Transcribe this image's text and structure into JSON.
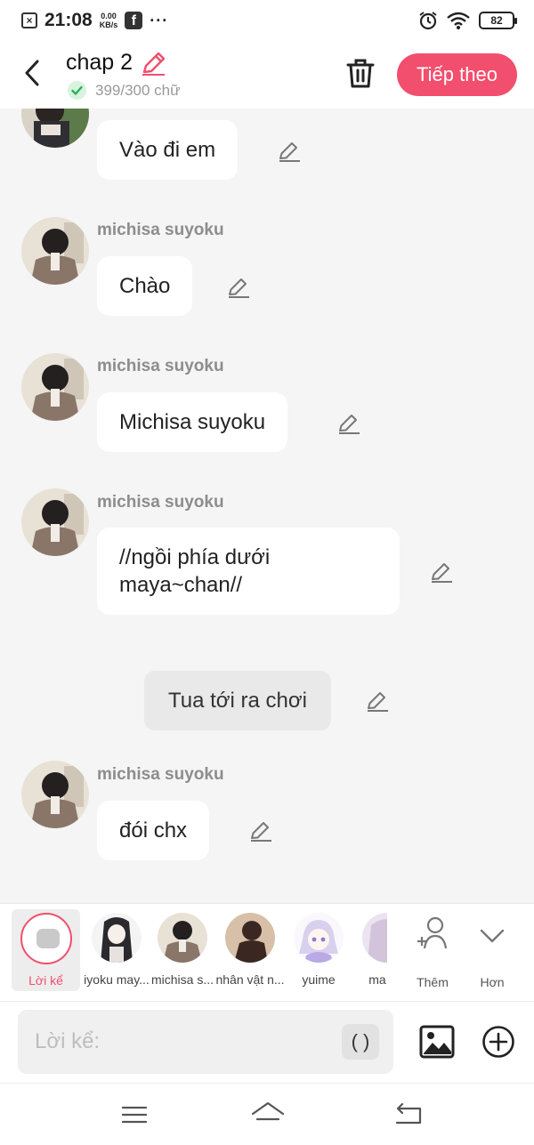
{
  "status_bar": {
    "time": "21:08",
    "net_speed_value": "0.00",
    "net_speed_unit": "KB/s",
    "battery": "82",
    "icons": [
      "close-notification-icon",
      "facebook-icon",
      "more-dots-icon",
      "alarm-icon",
      "wifi-icon",
      "battery-icon"
    ]
  },
  "header": {
    "title": "chap 2",
    "word_count": "399/300 chữ",
    "next_label": "Tiếp theo",
    "accent_color": "#f24e6d"
  },
  "chat": {
    "messages": [
      {
        "type": "character",
        "sender": "",
        "text": "Vào đi em"
      },
      {
        "type": "character",
        "sender": "michisa suyoku",
        "text": "Chào"
      },
      {
        "type": "character",
        "sender": "michisa suyoku",
        "text": "Michisa suyoku"
      },
      {
        "type": "character",
        "sender": "michisa suyoku",
        "text": "//ngồi phía dưới maya~chan//"
      },
      {
        "type": "narration",
        "text": "Tua tới ra chơi"
      },
      {
        "type": "character",
        "sender": "michisa suyoku",
        "text": "đói chx"
      }
    ]
  },
  "characters": {
    "narrator_label": "Lời kể",
    "items": [
      "iyoku may...",
      "michisa s...",
      "nhân vật n...",
      "yuime",
      "ma"
    ],
    "add_label": "Thêm",
    "more_label": "Hơn"
  },
  "input": {
    "placeholder": "Lời kể:",
    "paren_label": "( )"
  }
}
